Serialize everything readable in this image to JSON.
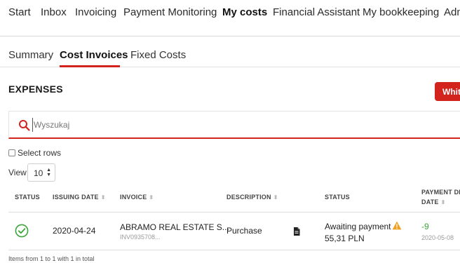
{
  "nav": {
    "start": "Start",
    "inbox": "Inbox",
    "invoicing": "Invoicing",
    "payment_monitoring": "Payment Monitoring",
    "my_costs": "My costs",
    "financial_assistant": "Financial Assistant",
    "my_bookkeeping": "My bookkeeping",
    "admin": "Adm"
  },
  "subnav": {
    "summary": "Summary",
    "cost_invoices": "Cost Invoices",
    "fixed_costs": "Fixed Costs"
  },
  "page": {
    "title": "EXPENSES",
    "action_button": "Whit"
  },
  "search": {
    "placeholder": "Wyszukaj"
  },
  "controls": {
    "select_rows": "Select rows",
    "view_label": "View",
    "view_value": "10"
  },
  "table": {
    "headers": {
      "status": "STATUS",
      "issuing_date": "ISSUING DATE",
      "invoice": "INVOICE",
      "description": "DESCRIPTION",
      "payment_status": "STATUS",
      "payment_date_line1": "PAYMENT DE",
      "payment_date_line2": "DATE"
    },
    "rows": [
      {
        "issuing_date": "2020-04-24",
        "invoice_name": "ABRAMO REAL ESTATE S...",
        "invoice_number": "INV0935708...",
        "description": "Purchase",
        "payment_status": "Awaiting payment",
        "amount": "55,31 PLN",
        "days": "-9",
        "payment_date": "2020-05-08"
      }
    ],
    "footer": "Items from 1 to 1 with 1 in total"
  },
  "colors": {
    "accent": "#d2231d",
    "ok": "#3aa53a",
    "warning": "#f0a020"
  }
}
